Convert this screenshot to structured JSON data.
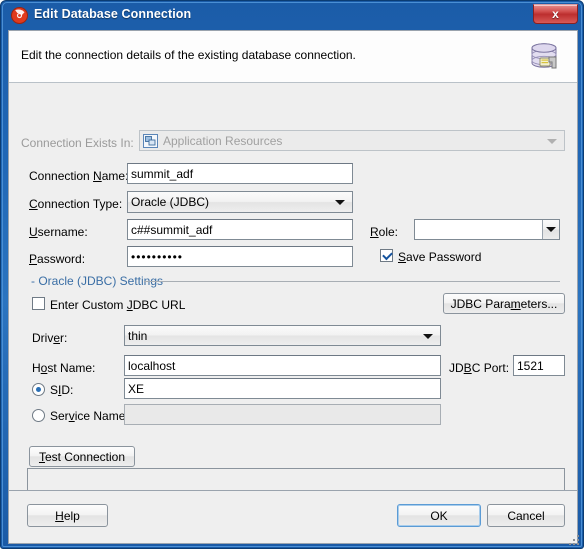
{
  "window": {
    "title": "Edit Database Connection",
    "title_icon": "jdeveloper-logo-icon",
    "close_label": "x"
  },
  "header": {
    "description": "Edit the connection details of the existing database connection.",
    "icon": "database-connection-icon"
  },
  "form": {
    "connection_exists_in": {
      "label": "Connection Exists In:",
      "value": "Application Resources",
      "icon": "application-resources-icon",
      "disabled": true
    },
    "connection_name": {
      "label_pre": "Connection ",
      "label_mn": "N",
      "label_post": "ame:",
      "value": "summit_adf"
    },
    "connection_type": {
      "label_pre": "",
      "label_mn": "C",
      "label_post": "onnection Type:",
      "value": "Oracle (JDBC)"
    },
    "username": {
      "label_pre": "",
      "label_mn": "U",
      "label_post": "sername:",
      "value": "c##summit_adf"
    },
    "password": {
      "label_pre": "",
      "label_mn": "P",
      "label_post": "assword:",
      "value": "••••••••••"
    },
    "role": {
      "label_pre": "",
      "label_mn": "R",
      "label_post": "ole:",
      "value": ""
    },
    "save_password": {
      "label_pre": "",
      "label_mn": "S",
      "label_post": "ave Password",
      "checked": true
    }
  },
  "group": {
    "title": "- Oracle (JDBC) Settings",
    "custom_url": {
      "label_pre": "Enter Custom ",
      "label_mn": "J",
      "label_post": "DBC URL",
      "checked": false
    },
    "jdbc_params_button": {
      "label_pre": "JDBC Para",
      "label_mn": "m",
      "label_post": "eters..."
    },
    "driver": {
      "label_pre": "Driv",
      "label_mn": "e",
      "label_post": "r:",
      "value": "thin"
    },
    "host_name": {
      "label_pre": "H",
      "label_mn": "o",
      "label_post": "st Name:",
      "value": "localhost"
    },
    "jdbc_port": {
      "label_pre": "JD",
      "label_mn": "B",
      "label_post": "C Port:",
      "value": "1521"
    },
    "sid": {
      "label_pre": "S",
      "label_mn": "I",
      "label_post": "D:",
      "value": "XE",
      "selected": true
    },
    "service_name": {
      "label_pre": "Ser",
      "label_mn": "v",
      "label_post": "ice Name:",
      "value": "",
      "selected": false
    }
  },
  "test": {
    "button": {
      "label_pre": "",
      "label_mn": "T",
      "label_post": "est Connection"
    },
    "output": ""
  },
  "footer": {
    "help": {
      "label_pre": "",
      "label_mn": "H",
      "label_post": "elp"
    },
    "ok": {
      "label": "OK"
    },
    "cancel": {
      "label": "Cancel"
    }
  },
  "colors": {
    "titlebar_blue": "#1f66b5",
    "accent_link": "#3a6ea5",
    "close_red": "#bc2e2e",
    "focus_blue": "#5b9bd5"
  }
}
